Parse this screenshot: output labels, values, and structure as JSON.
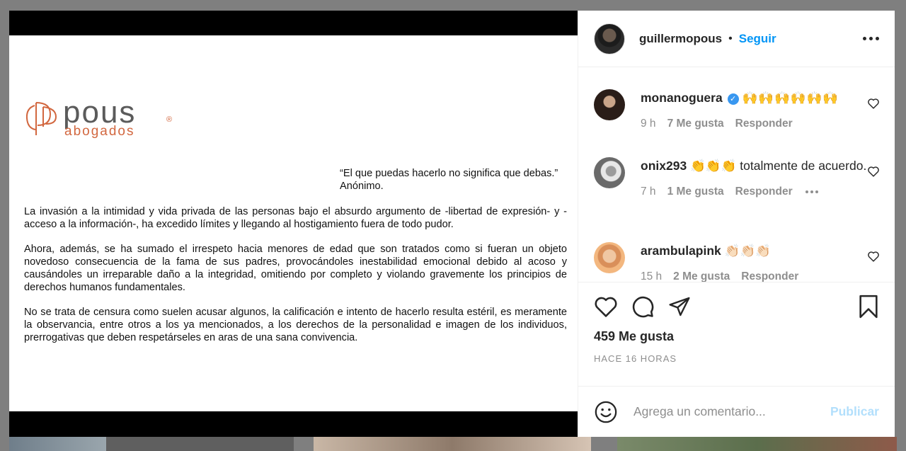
{
  "post": {
    "logo": {
      "word": "pous",
      "sub": "abogados",
      "reg": "®"
    },
    "quote": {
      "text": "“El que puedas hacerlo no significa que debas.”",
      "author": "Anónimo."
    },
    "paragraphs": [
      "La invasión a la intimidad y vida privada de las personas bajo el absurdo argumento de -libertad de expresión- y -acceso a la información-, ha excedido límites y llegando al hostigamiento fuera de todo pudor.",
      "Ahora, además, se ha sumado el irrespeto hacia menores de edad que son tratados como si fueran un objeto novedoso consecuencia de la fama de sus padres, provocándoles inestabilidad emocional debido al acoso y causándoles un irreparable daño a la integridad, omitiendo por completo y violando gravemente los principios de derechos humanos fundamentales.",
      "No se trata de censura como suelen acusar algunos, la calificación e intento de hacerlo resulta estéril, es meramente la observancia, entre otros a los ya mencionados, a los derechos de la personalidad e imagen de los individuos, prerrogativas que deben respetárseles en aras de una sana convivencia."
    ]
  },
  "header": {
    "username": "guillermopous",
    "separator": "•",
    "follow_label": "Seguir",
    "more_icon": "more-horizontal-icon"
  },
  "comments": [
    {
      "user": "monanoguera",
      "verified": true,
      "text": "🙌🙌🙌🙌🙌🙌",
      "time": "9 h",
      "likes": "7 Me gusta",
      "reply": "Responder"
    },
    {
      "user": "onix293",
      "verified": false,
      "text": "👏👏👏 totalmente de acuerdo.",
      "time": "7 h",
      "likes": "1 Me gusta",
      "reply": "Responder"
    },
    {
      "user": "arambulapink",
      "verified": false,
      "text": "👏🏻👏🏻👏🏻",
      "time": "15 h",
      "likes": "2 Me gusta",
      "reply": "Responder"
    }
  ],
  "actions": {
    "icons": [
      "heart-icon",
      "comment-icon",
      "share-icon",
      "bookmark-icon"
    ],
    "likes_label": "459 Me gusta",
    "timestamp": "HACE 16 HORAS"
  },
  "composer": {
    "emoji_icon": "smiley-icon",
    "placeholder": "Agrega un comentario...",
    "publish_label": "Publicar"
  },
  "colors": {
    "accent": "#0095f6",
    "publish_disabled": "#b2dffc",
    "logo_orange": "#d2673f",
    "muted": "#8e8e8e"
  }
}
